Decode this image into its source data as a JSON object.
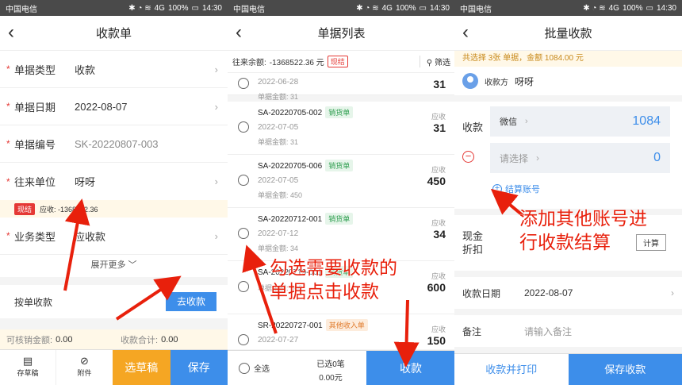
{
  "status": {
    "carrier": "中国电信",
    "battery": "100%",
    "time": "14:30",
    "signal": "4G"
  },
  "p1": {
    "title": "收款单",
    "rows": [
      {
        "label": "单据类型",
        "value": "收款"
      },
      {
        "label": "单据日期",
        "value": "2022-08-07"
      },
      {
        "label": "单据编号",
        "value": "SK-20220807-003"
      },
      {
        "label": "往来单位",
        "value": "呀呀"
      }
    ],
    "balance_badge": "现结",
    "balance_text": "应收: -1368522.36",
    "biz_label": "业务类型",
    "biz_value": "应收款",
    "expand": "展开更多",
    "by_bill": "按单收款",
    "go_collect": "去收款",
    "writeoff_label": "可核销金额:",
    "writeoff_value": "0.00",
    "total_label": "收款合计:",
    "total_value": "0.00",
    "bottom": {
      "draft": "存草稿",
      "attach": "附件",
      "pick": "选草稿",
      "save": "保存"
    }
  },
  "p2": {
    "title": "单据列表",
    "balance_label": "往来余额:",
    "balance_value": "-1368522.36 元",
    "badge": "现结",
    "filter": "筛选",
    "items": [
      {
        "no": "",
        "tag": "",
        "date": "2022-06-28",
        "amt": "单据金额: 31",
        "lbl": "",
        "val": "31"
      },
      {
        "no": "SA-20220705-002",
        "tag": "销货单",
        "date": "2022-07-05",
        "amt": "单据金额: 31",
        "lbl": "应收",
        "val": "31"
      },
      {
        "no": "SA-20220705-006",
        "tag": "销货单",
        "date": "2022-07-05",
        "amt": "单据金额: 450",
        "lbl": "应收",
        "val": "450"
      },
      {
        "no": "SA-20220712-001",
        "tag": "销货单",
        "date": "2022-07-12",
        "amt": "单据金额: 34",
        "lbl": "应收",
        "val": "34"
      },
      {
        "no": "SA-20220719-001",
        "tag": "销货单",
        "date": "",
        "amt": "单据金额: 600",
        "lbl": "应收",
        "val": "600"
      },
      {
        "no": "SR-20220727-001",
        "tag": "其他收入单",
        "date": "2022-07-27",
        "amt": "",
        "lbl": "应收",
        "val": "150"
      }
    ],
    "select_all": "全选",
    "selected": "已选0笔",
    "selected_amt": "0.00元",
    "collect": "收款"
  },
  "p3": {
    "title": "批量收款",
    "notice": "共选择 3张 单据，金额 1084.00 元",
    "payer_label": "收款方",
    "payer_name": "呀呀",
    "collect_label": "收款",
    "acct1": "微信",
    "amt1": "1084",
    "acct2_placeholder": "请选择",
    "amt2": "0",
    "add_account": "结算账号",
    "cash_discount": "现金\n折扣",
    "calc": "计算",
    "date_label": "收款日期",
    "date_value": "2022-08-07",
    "remark_label": "备注",
    "remark_placeholder": "请输入备注",
    "print_btn": "收款并打印",
    "save_btn": "保存收款"
  },
  "annotations": {
    "a1_line1": "勾选需要收款的",
    "a1_line2": "单据点击收款",
    "a2_line1": "添加其他账号进",
    "a2_line2": "行收款结算"
  },
  "colors": {
    "primary": "#3d8eea",
    "orange": "#f5a623",
    "red": "#e53935",
    "annotation": "#e8200c"
  }
}
